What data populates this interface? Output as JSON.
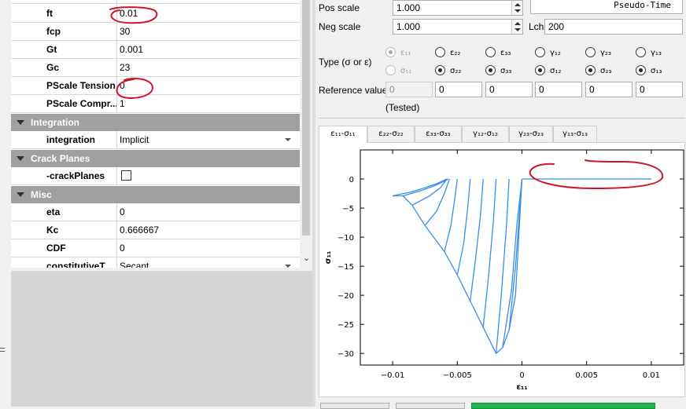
{
  "properties": {
    "rows_top": [
      {
        "name": "ft",
        "value": "0.01"
      },
      {
        "name": "fcp",
        "value": "30"
      },
      {
        "name": "Gt",
        "value": "0.001"
      },
      {
        "name": "Gc",
        "value": "23"
      },
      {
        "name": "PScale Tension",
        "value": "0"
      },
      {
        "name": "PScale Compr...",
        "value": "1"
      }
    ],
    "integration_group": "Integration",
    "integration": {
      "name": "integration",
      "value": "Implicit"
    },
    "crack_group": "Crack Planes",
    "crack": {
      "name": "-crackPlanes"
    },
    "misc_group": "Misc",
    "misc_rows": [
      {
        "name": "eta",
        "value": "0"
      },
      {
        "name": "Kc",
        "value": "0.666667"
      },
      {
        "name": "CDF",
        "value": "0"
      }
    ],
    "partial_row": {
      "name": "constitutiveT...",
      "value": "Secant"
    }
  },
  "controls": {
    "pos_scale_label": "Pos scale",
    "pos_scale_value": "1.000",
    "neg_scale_label": "Neg scale",
    "neg_scale_value": "1.000",
    "lch_label": "Lch",
    "lch_value": "200",
    "pseudo_time_label": "Pseudo-Time",
    "type_label": "Type (σ or ε)",
    "reference_label": "Reference value",
    "tested_label": "(Tested)",
    "eps_labels": [
      "ε₁₁",
      "ε₂₂",
      "ε₃₃",
      "γ₁₂",
      "γ₂₃",
      "γ₁₃"
    ],
    "sig_labels": [
      "σ₁₁",
      "σ₂₂",
      "σ₃₃",
      "σ₁₂",
      "σ₂₃",
      "σ₁₃"
    ],
    "reference_values": [
      "0",
      "0",
      "0",
      "0",
      "0",
      "0"
    ],
    "selected_row": [
      "eps",
      "sig",
      "sig",
      "sig",
      "sig",
      "sig"
    ]
  },
  "tabs": [
    "ε₁₁-σ₁₁",
    "ε₂₂-σ₂₂",
    "ε₃₃-σ₃₃",
    "γ₁₂-σ₁₂",
    "γ₂₃-σ₂₃",
    "γ₁₃-σ₁₃"
  ],
  "active_tab": 0,
  "colors": {
    "accent": "#3b8ee8",
    "annotation": "#d2142a",
    "group_header": "#a0a0a0"
  },
  "chart_data": {
    "type": "line",
    "xlabel": "ε₁₁",
    "ylabel": "σ₁₁",
    "xlim": [
      -0.0125,
      0.0125
    ],
    "ylim": [
      -32,
      5
    ],
    "xticks": [
      -0.01,
      -0.005,
      0,
      0.005,
      0.01
    ],
    "xtick_labels": [
      "−0.01",
      "−0.005",
      "0",
      "0.005",
      "0.01"
    ],
    "yticks": [
      0,
      -5,
      -10,
      -15,
      -20,
      -25,
      -30
    ],
    "ytick_labels": [
      "0",
      "−5",
      "−10",
      "−15",
      "−20",
      "−25",
      "−30"
    ],
    "color": "#3b8ee8",
    "series": [
      {
        "x": [
          0,
          0.01
        ],
        "y": [
          0,
          0
        ]
      },
      {
        "x": [
          -0.01,
          -0.0092,
          -0.0085,
          -0.0075,
          -0.006,
          -0.005,
          -0.004,
          -0.003,
          -0.002,
          -0.0015,
          -0.001,
          -0.0005,
          0
        ],
        "y": [
          -2.9,
          -2.9,
          -4.5,
          -8,
          -12.5,
          -16.5,
          -21,
          -25.5,
          -30,
          -29,
          -26,
          -20,
          0
        ]
      },
      {
        "x": [
          -0.01,
          -0.0085,
          -0.0075,
          -0.0066,
          -0.0058
        ],
        "y": [
          -2.9,
          -2.2,
          -1.5,
          -0.8,
          0
        ]
      },
      {
        "x": [
          -0.0092,
          -0.0078,
          -0.0068,
          -0.0061,
          -0.0057
        ],
        "y": [
          -2.9,
          -2.0,
          -1.2,
          -0.5,
          0
        ]
      },
      {
        "x": [
          -0.0085,
          -0.0072,
          -0.0063,
          -0.0058
        ],
        "y": [
          -4.5,
          -3.0,
          -1.5,
          0
        ]
      },
      {
        "x": [
          -0.0075,
          -0.0066,
          -0.006,
          -0.0056
        ],
        "y": [
          -8,
          -5.5,
          -2.5,
          0
        ]
      },
      {
        "x": [
          -0.006,
          -0.0055,
          -0.0052,
          -0.005
        ],
        "y": [
          -12.5,
          -8,
          -3.5,
          0
        ]
      },
      {
        "x": [
          -0.005,
          -0.0045,
          -0.0042,
          -0.004
        ],
        "y": [
          -16.5,
          -11,
          -5,
          0
        ]
      },
      {
        "x": [
          -0.004,
          -0.0036,
          -0.0032,
          -0.003
        ],
        "y": [
          -21,
          -14,
          -6,
          0
        ]
      },
      {
        "x": [
          -0.003,
          -0.0026,
          -0.0022,
          -0.002
        ],
        "y": [
          -25.5,
          -17,
          -7,
          0
        ]
      },
      {
        "x": [
          -0.002,
          -0.0016,
          -0.0012,
          -0.001
        ],
        "y": [
          -30,
          -20,
          -8,
          0
        ]
      },
      {
        "x": [
          -0.0015,
          -0.0008,
          -0.0004,
          0
        ],
        "y": [
          -29,
          -19,
          -8,
          0
        ]
      },
      {
        "x": [
          -0.001,
          -0.0005,
          -0.0002,
          0
        ],
        "y": [
          -26,
          -15,
          -6,
          0
        ]
      }
    ]
  }
}
